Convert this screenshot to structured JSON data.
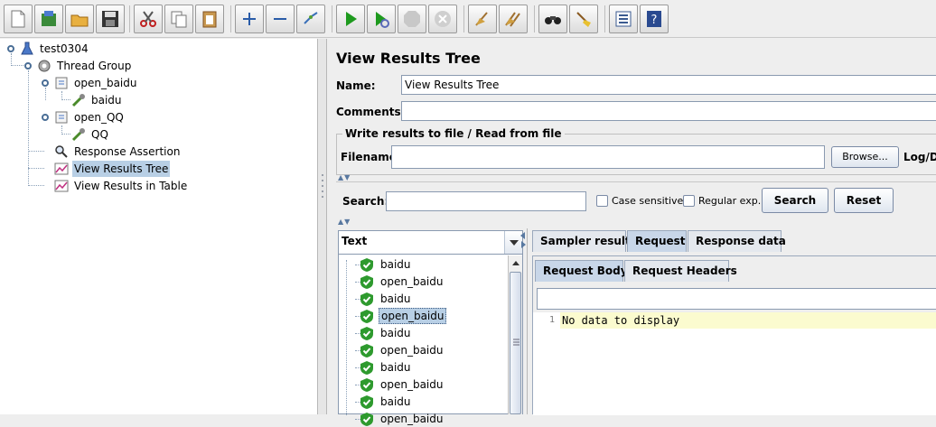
{
  "toolbar": {
    "buttons": [
      {
        "name": "new-icon"
      },
      {
        "name": "templates-icon"
      },
      {
        "name": "open-icon"
      },
      {
        "name": "save-icon"
      },
      {
        "name": "cut-icon"
      },
      {
        "name": "copy-icon"
      },
      {
        "name": "paste-icon"
      },
      {
        "name": "expand-icon"
      },
      {
        "name": "collapse-icon"
      },
      {
        "name": "toggle-icon"
      },
      {
        "name": "start-icon"
      },
      {
        "name": "start-no-pauses-icon"
      },
      {
        "name": "stop-icon"
      },
      {
        "name": "shutdown-icon"
      },
      {
        "name": "clear-icon"
      },
      {
        "name": "clear-all-icon"
      },
      {
        "name": "search-icon"
      },
      {
        "name": "reset-search-icon"
      },
      {
        "name": "function-helper-icon"
      },
      {
        "name": "help-icon"
      }
    ]
  },
  "tree": {
    "items": [
      {
        "label": "test0304",
        "icon": "test-plan-icon"
      },
      {
        "label": "Thread Group",
        "icon": "thread-group-icon"
      },
      {
        "label": "open_baidu",
        "icon": "transaction-controller-icon"
      },
      {
        "label": "baidu",
        "icon": "sampler-icon"
      },
      {
        "label": "open_QQ",
        "icon": "transaction-controller-icon"
      },
      {
        "label": "QQ",
        "icon": "sampler-icon"
      },
      {
        "label": "Response Assertion",
        "icon": "assertion-icon"
      },
      {
        "label": "View Results Tree",
        "icon": "listener-icon",
        "selected": true
      },
      {
        "label": "View Results in Table",
        "icon": "listener-icon"
      }
    ]
  },
  "panel": {
    "title": "View Results Tree",
    "name_label": "Name:",
    "name_value": "View Results Tree",
    "comments_label": "Comments:",
    "comments_value": "",
    "file_group_title": "Write results to file / Read from file",
    "filename_label": "Filename",
    "filename_value": "",
    "browse_label": "Browse...",
    "log_label": "Log/Di",
    "search_label": "Search:",
    "search_value": "",
    "case_sensitive_label": "Case sensitive",
    "regular_exp_label": "Regular exp.",
    "search_button": "Search",
    "reset_button": "Reset"
  },
  "results": {
    "renderer": "Text",
    "items": [
      {
        "label": "baidu",
        "status": "success"
      },
      {
        "label": "open_baidu",
        "status": "success"
      },
      {
        "label": "baidu",
        "status": "success"
      },
      {
        "label": "open_baidu",
        "status": "success",
        "selected": true
      },
      {
        "label": "baidu",
        "status": "success"
      },
      {
        "label": "open_baidu",
        "status": "success"
      },
      {
        "label": "baidu",
        "status": "success"
      },
      {
        "label": "open_baidu",
        "status": "success"
      },
      {
        "label": "baidu",
        "status": "success"
      },
      {
        "label": "open_baidu",
        "status": "success"
      }
    ]
  },
  "tabs": {
    "main": [
      "Sampler result",
      "Request",
      "Response data"
    ],
    "main_active": "Request",
    "sub": [
      "Request Body",
      "Request Headers"
    ],
    "sub_active": "Request Body"
  },
  "editor": {
    "line_number": "1",
    "content": "No data to display"
  },
  "colors": {
    "selection": "#b8cfe5",
    "editor_highlight": "#fbfbcf",
    "success": "#2e9a2e"
  }
}
